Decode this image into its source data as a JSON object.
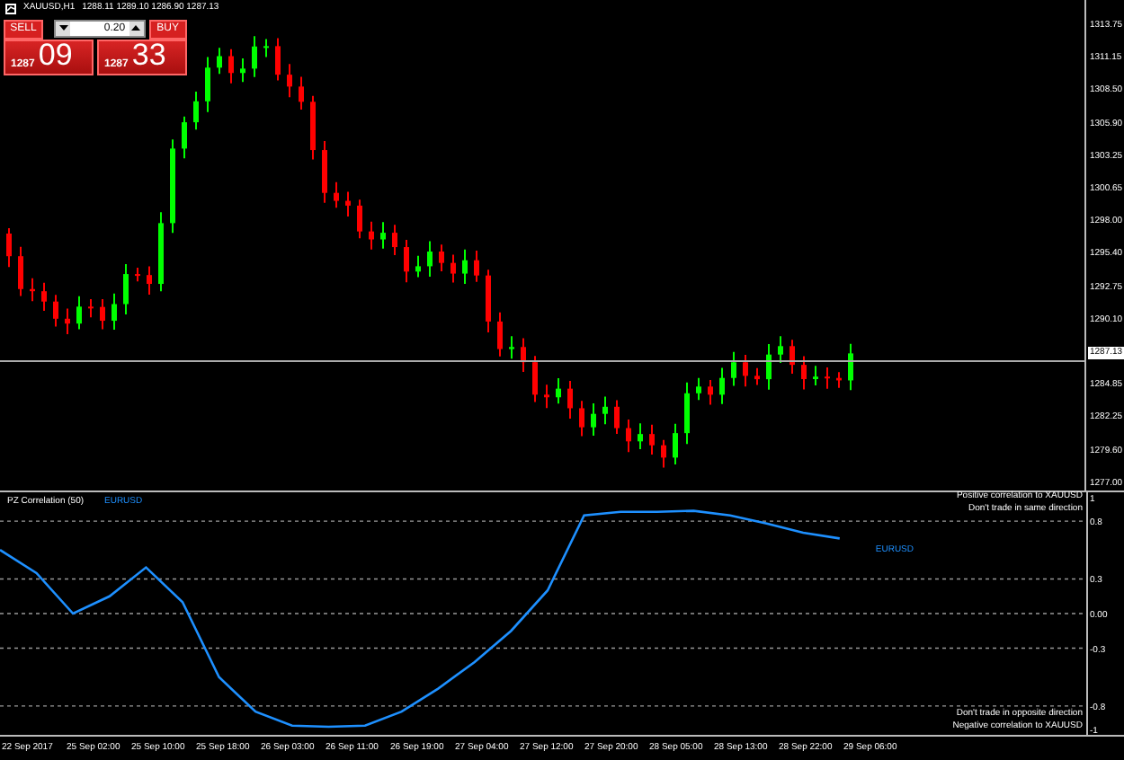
{
  "chart_header": {
    "symbol": "XAUUSD,H1",
    "ohlc": "1288.11 1289.10 1286.90 1287.13"
  },
  "trade_panel": {
    "sell_label": "SELL",
    "lot": "0.20",
    "buy_label": "BUY",
    "sell_price_small": "1287",
    "sell_price_big": "09",
    "buy_price_small": "1287",
    "buy_price_big": "33"
  },
  "price_axis": [
    {
      "kind": "tick",
      "text": "1313.75"
    },
    {
      "kind": "tick",
      "text": "1311.15"
    },
    {
      "kind": "tick",
      "text": "1308.50"
    },
    {
      "kind": "tick",
      "text": "1305.90"
    },
    {
      "kind": "tick",
      "text": "1303.25"
    },
    {
      "kind": "tick",
      "text": "1300.65"
    },
    {
      "kind": "tick",
      "text": "1298.00"
    },
    {
      "kind": "tick",
      "text": "1295.40"
    },
    {
      "kind": "tick",
      "text": "1292.75"
    },
    {
      "kind": "tick",
      "text": "1290.10"
    },
    {
      "kind": "current",
      "text": "1287.13"
    },
    {
      "kind": "tick",
      "text": "1284.85"
    },
    {
      "kind": "tick",
      "text": "1282.25"
    },
    {
      "kind": "tick",
      "text": "1279.60"
    },
    {
      "kind": "tick",
      "text": "1277.00"
    }
  ],
  "indicator": {
    "title": "PZ Correlation (50)",
    "line_label": "EURUSD",
    "top_notes": [
      "Positive correlation to XAUUSD",
      "Don't trade in same direction"
    ],
    "bottom_notes": [
      "Don't trade in opposite direction",
      "Negative correlation to XAUUSD"
    ],
    "chart_data": {
      "type": "line",
      "grid": true,
      "ylim": [
        -1.05,
        1.05
      ],
      "yticks": [
        {
          "value": 1,
          "label": "1"
        },
        {
          "value": 0.8,
          "label": "0.8"
        },
        {
          "value": 0.3,
          "label": "0.3"
        },
        {
          "value": 0,
          "label": "0.00"
        },
        {
          "value": -0.3,
          "label": "-0.3"
        },
        {
          "value": -0.8,
          "label": "-0.8"
        },
        {
          "value": -1,
          "label": "-1"
        }
      ],
      "series": [
        {
          "name": "EURUSD",
          "color": "#1e90ff",
          "values": [
            0.55,
            0.35,
            0.0,
            0.15,
            0.4,
            0.1,
            -0.55,
            -0.85,
            -0.97,
            -0.98,
            -0.97,
            -0.85,
            -0.65,
            -0.42,
            -0.15,
            0.2,
            0.85,
            0.88,
            0.88,
            0.89,
            0.85,
            0.78,
            0.7,
            0.65
          ]
        }
      ]
    }
  },
  "time_axis": [
    "22 Sep 2017",
    "25 Sep 02:00",
    "25 Sep 10:00",
    "25 Sep 18:00",
    "26 Sep 03:00",
    "26 Sep 11:00",
    "26 Sep 19:00",
    "27 Sep 04:00",
    "27 Sep 12:00",
    "27 Sep 20:00",
    "28 Sep 05:00",
    "28 Sep 13:00",
    "28 Sep 22:00",
    "29 Sep 06:00"
  ]
}
